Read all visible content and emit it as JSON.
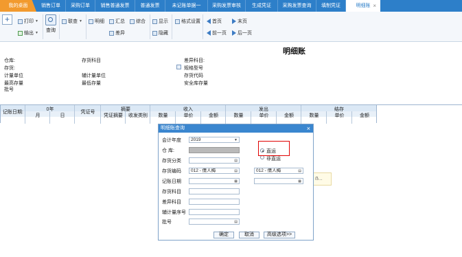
{
  "tabs": [
    {
      "label": "我的桌面"
    },
    {
      "label": "销售订单"
    },
    {
      "label": "采购订单"
    },
    {
      "label": "销售普通发票"
    },
    {
      "label": "普通发票"
    },
    {
      "label": "未记账单据一"
    },
    {
      "label": "采购发票审核"
    },
    {
      "label": "生成凭证"
    },
    {
      "label": "采购发票查询"
    },
    {
      "label": "填制凭证"
    },
    {
      "label": "明细账"
    }
  ],
  "toolbar": {
    "print": "打印",
    "export": "输出",
    "query": "查询",
    "union": "联查",
    "detail": "明细",
    "summary": "汇总",
    "difference": "差异",
    "comprehensive": "综合",
    "display": "显示",
    "hide": "隐藏",
    "format_settings": "格式设置",
    "first_page": "首页",
    "last_page": "末页",
    "prev_page": "前一页",
    "next_page": "后一页"
  },
  "report": {
    "title": "明细账",
    "fields": {
      "warehouse": "仓库:",
      "inventory": "存货:",
      "measure_unit": "计量单位",
      "max_stock": "最高存量",
      "batch_no": "批号",
      "inventory_subject": "存货科目",
      "aux_unit": "辅计量单位",
      "min_stock": "最低存量",
      "diff_subject": "差异科目:",
      "spec_model": "规格型号",
      "inventory_code": "存货代码",
      "safety_stock": "安全库存量"
    }
  },
  "grid": {
    "book_date": "记账日期:",
    "year_2019_0": "0年",
    "month": "月",
    "day": "日",
    "voucher_no": "凭证号",
    "abstract": "摘要",
    "voucher_abstract": "凭证摘要",
    "receipt_type": "收发类别",
    "in": "收入",
    "out": "发出",
    "balance": "结存",
    "qty": "数量",
    "price": "单价",
    "amount": "金额"
  },
  "dialog": {
    "title": "明细账查询",
    "fiscal_year_label": "会计年度",
    "fiscal_year_value": "2019",
    "warehouse_label": "仓    库:",
    "inventory_class_label": "存货分类",
    "inventory_code_label": "存货编码",
    "inventory_code_from": "012 - 倩人梅",
    "inventory_code_to": "012 - 倩人梅",
    "book_date_label": "记账日期",
    "inventory_subject_label": "存货科目",
    "diff_subject_label": "差异科目",
    "aux_unit_label": "辅计量序号",
    "batch_label": "批号",
    "radio_direct": "直运",
    "radio_non_direct": "非直运",
    "ok": "确定",
    "cancel": "取消",
    "advanced": "高级选项>>"
  },
  "tooltip_text": "ẞ..."
}
